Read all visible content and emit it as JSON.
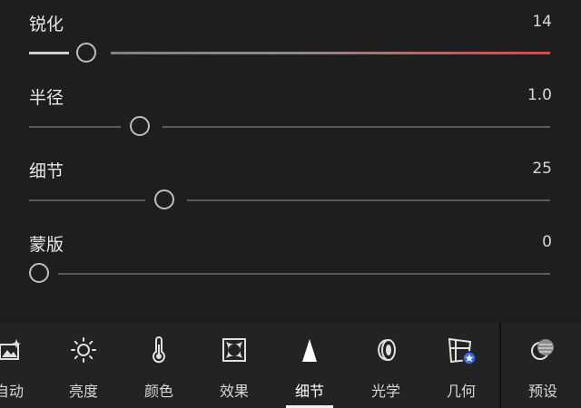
{
  "sliders": [
    {
      "label": "锐化",
      "value": "14",
      "level": 0.11
    },
    {
      "label": "半径",
      "value": "1.0",
      "level": 0.215
    },
    {
      "label": "细节",
      "value": "25",
      "level": 0.26
    },
    {
      "label": "蒙版",
      "value": "0",
      "level": 0.0
    }
  ],
  "toolbar": {
    "auto": "自动",
    "light": "亮度",
    "color": "颜色",
    "effects": "效果",
    "detail": "细节",
    "optics": "光学",
    "geometry": "几何",
    "presets": "预设"
  },
  "colors": {
    "accent": "#e0444a",
    "track": "#5a5a5a",
    "background": "#1e1e1e"
  }
}
